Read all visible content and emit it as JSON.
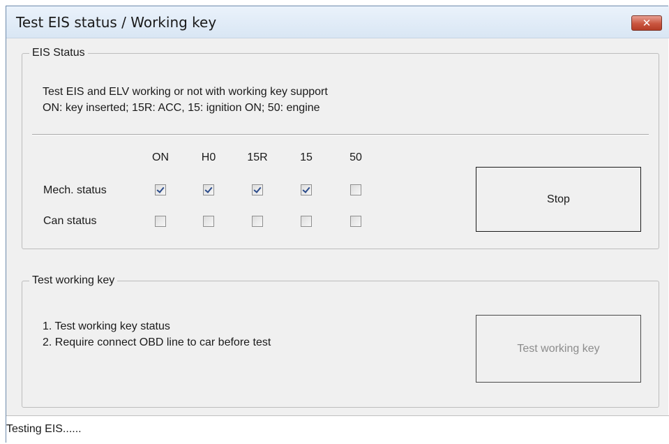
{
  "window": {
    "title": "Test EIS status / Working key",
    "close_label": "✕"
  },
  "eis_status": {
    "legend": "EIS Status",
    "description_line1": "Test EIS and ELV working or not with working key support",
    "description_line2": "ON: key inserted; 15R: ACC, 15: ignition ON; 50: engine",
    "columns": [
      "ON",
      "H0",
      "15R",
      "15",
      "50"
    ],
    "rows": [
      {
        "label": "Mech. status",
        "checked": [
          true,
          true,
          true,
          true,
          false
        ]
      },
      {
        "label": "Can status",
        "checked": [
          false,
          false,
          false,
          false,
          false
        ]
      }
    ],
    "stop_button_label": "Stop"
  },
  "working_key": {
    "legend": "Test working key",
    "line1": "1. Test working key status",
    "line2": "2. Require connect OBD line to car before test",
    "test_button_label": "Test working key",
    "test_button_enabled": false
  },
  "status_bar": {
    "text": "Testing EIS......"
  },
  "colors": {
    "title_bar": "#dce8f5",
    "close_button": "#c9553f",
    "window_background": "#f0f0f0",
    "checkmark": "#2a4a8a",
    "disabled_text": "#8c8c8c"
  }
}
